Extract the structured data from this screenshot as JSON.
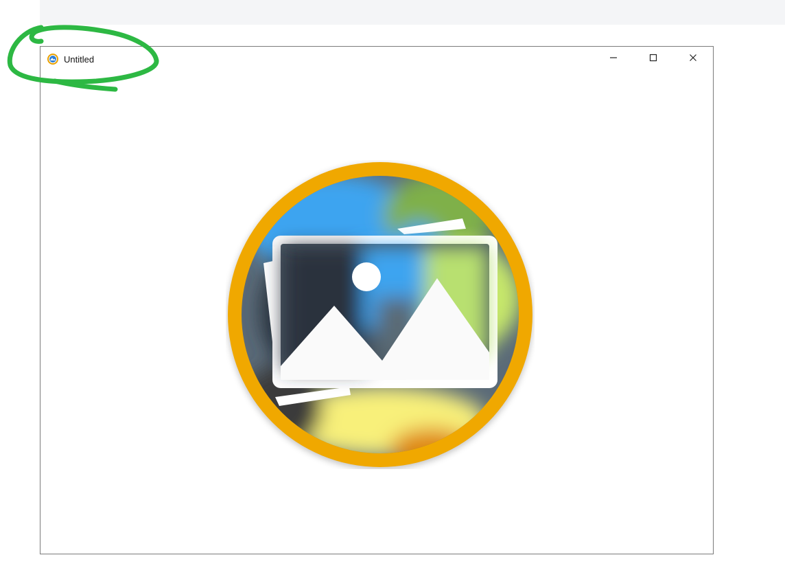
{
  "window": {
    "title": "Untitled",
    "app_icon": "app-logo-icon",
    "controls": {
      "minimize_icon": "minimize-icon",
      "maximize_icon": "maximize-icon",
      "close_icon": "close-icon"
    }
  },
  "content": {
    "placeholder_icon": "image-placeholder-icon"
  },
  "colors": {
    "badge_ring": "#f0a800",
    "annotation_stroke": "#2db843",
    "window_border": "#7a7a7a"
  }
}
